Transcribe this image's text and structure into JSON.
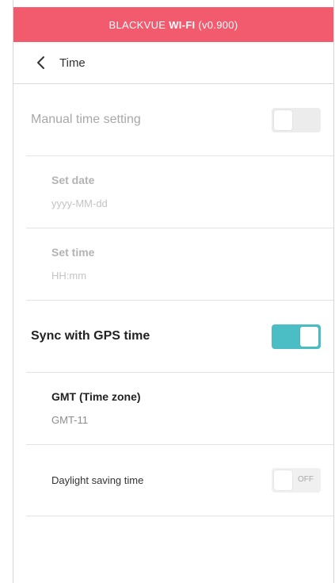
{
  "app_bar": {
    "title_prefix": "BLACKVUE ",
    "title_bold": "WI-FI",
    "title_suffix": " (v0.900)",
    "color": "#f25a6e"
  },
  "nav": {
    "back_icon": "chevron-left-icon",
    "title": "Time"
  },
  "settings": {
    "manual_time": {
      "label": "Manual time setting",
      "enabled": false
    },
    "set_date": {
      "label": "Set date",
      "value": "yyyy-MM-dd"
    },
    "set_time": {
      "label": "Set time",
      "value": "HH:mm"
    },
    "gps_sync": {
      "label": "Sync with GPS time",
      "enabled": true,
      "color": "#4bbdc5"
    },
    "timezone": {
      "label": "GMT (Time zone)",
      "value": "GMT-11"
    },
    "daylight_saving": {
      "label": "Daylight saving time",
      "state_text": "OFF",
      "enabled": false
    }
  }
}
